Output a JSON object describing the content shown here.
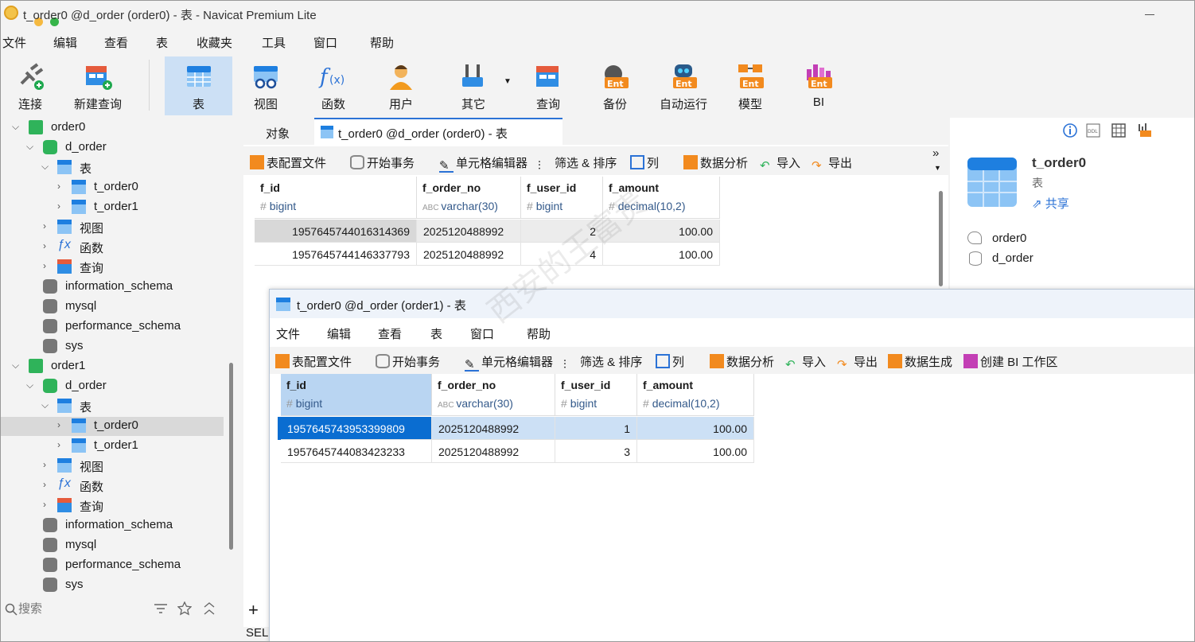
{
  "window": {
    "title": "t_order0 @d_order (order0) - 表 - Navicat Premium Lite"
  },
  "menu": [
    "文件",
    "编辑",
    "查看",
    "表",
    "收藏夹",
    "工具",
    "窗口",
    "帮助"
  ],
  "toolbar": [
    "连接",
    "新建查询",
    "表",
    "视图",
    "函数",
    "用户",
    "其它",
    "查询",
    "备份",
    "自动运行",
    "模型",
    "BI"
  ],
  "sidebar": {
    "conn0": "order0",
    "db0": "d_order",
    "tables0": "表",
    "t00": "t_order0",
    "t01": "t_order1",
    "views0": "视图",
    "funcs0": "函数",
    "queries0": "查询",
    "is0": "information_schema",
    "mysql0": "mysql",
    "ps0": "performance_schema",
    "sys0": "sys",
    "conn1": "order1",
    "db1": "d_order",
    "tables1": "表",
    "t10": "t_order0",
    "t11": "t_order1",
    "views1": "视图",
    "funcs1": "函数",
    "queries1": "查询",
    "is1": "information_schema",
    "mysql1": "mysql",
    "ps1": "performance_schema",
    "sys1": "sys"
  },
  "search": {
    "placeholder": "搜索"
  },
  "status": {
    "text": "SELE"
  },
  "tabs": {
    "objects": "对象",
    "active": "t_order0 @d_order (order0) - 表"
  },
  "subtoolbar": [
    "表配置文件",
    "开始事务",
    "单元格编辑器",
    "筛选 & 排序",
    "列",
    "数据分析",
    "导入",
    "导出"
  ],
  "grid0": {
    "columns": [
      {
        "name": "f_id",
        "type": "bigint"
      },
      {
        "name": "f_order_no",
        "type": "varchar(30)"
      },
      {
        "name": "f_user_id",
        "type": "bigint"
      },
      {
        "name": "f_amount",
        "type": "decimal(10,2)"
      }
    ],
    "rows": [
      [
        "1957645744016314369",
        "2025120488992",
        "2",
        "100.00"
      ],
      [
        "1957645744146337793",
        "2025120488992",
        "4",
        "100.00"
      ]
    ]
  },
  "rpanel": {
    "title": "t_order0",
    "subtitle": "表",
    "share": "共享",
    "conn": "order0",
    "db": "d_order"
  },
  "fwin": {
    "title": "t_order0 @d_order (order1) - 表",
    "menu": [
      "文件",
      "编辑",
      "查看",
      "表",
      "窗口",
      "帮助"
    ],
    "toolbar": [
      "表配置文件",
      "开始事务",
      "单元格编辑器",
      "筛选 & 排序",
      "列",
      "数据分析",
      "导入",
      "导出",
      "数据生成",
      "创建 BI 工作区"
    ],
    "columns": [
      {
        "name": "f_id",
        "type": "bigint"
      },
      {
        "name": "f_order_no",
        "type": "varchar(30)"
      },
      {
        "name": "f_user_id",
        "type": "bigint"
      },
      {
        "name": "f_amount",
        "type": "decimal(10,2)"
      }
    ],
    "rows": [
      [
        "1957645743953399809",
        "2025120488992",
        "1",
        "100.00"
      ],
      [
        "1957645744083423233",
        "2025120488992",
        "3",
        "100.00"
      ]
    ]
  },
  "watermark": "西安的王富贵",
  "colors": {
    "accent": "#2b72d6",
    "selection": "#cce0f5",
    "cellSelected": "#0a6dd1"
  }
}
